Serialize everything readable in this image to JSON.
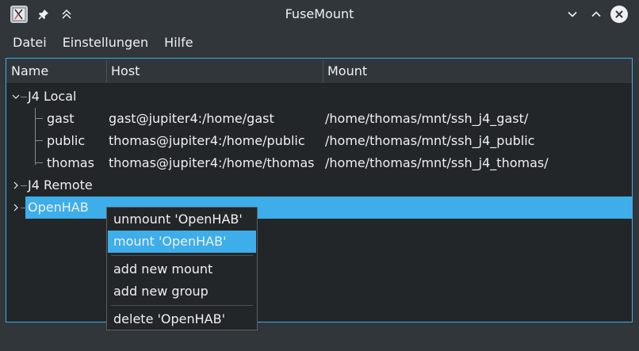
{
  "window": {
    "title": "FuseMount"
  },
  "menubar": {
    "items": [
      {
        "label": "Datei"
      },
      {
        "label": "Einstellungen"
      },
      {
        "label": "Hilfe"
      }
    ]
  },
  "tree": {
    "columns": [
      {
        "label": "Name"
      },
      {
        "label": "Host"
      },
      {
        "label": "Mount"
      }
    ],
    "groups": [
      {
        "name": "J4 Local",
        "expanded": true,
        "children": [
          {
            "name": "gast",
            "host": "gast@jupiter4:/home/gast",
            "mount": "/home/thomas/mnt/ssh_j4_gast/"
          },
          {
            "name": "public",
            "host": "thomas@jupiter4:/home/public",
            "mount": "/home/thomas/mnt/ssh_j4_public"
          },
          {
            "name": "thomas",
            "host": "thomas@jupiter4:/home/thomas",
            "mount": "/home/thomas/mnt/ssh_j4_thomas/"
          }
        ]
      },
      {
        "name": "J4 Remote",
        "expanded": false,
        "children": []
      },
      {
        "name": "OpenHAB",
        "expanded": false,
        "selected": true,
        "children": []
      }
    ]
  },
  "context_menu": {
    "items": [
      {
        "label": "unmount 'OpenHAB'"
      },
      {
        "label": "mount 'OpenHAB'",
        "active": true
      },
      {
        "label": "add new mount"
      },
      {
        "label": "add new group"
      },
      {
        "label": "delete 'OpenHAB'"
      }
    ]
  },
  "colors": {
    "accent": "#3daee9",
    "window_bg": "#31363b",
    "view_bg": "#232629",
    "text": "#eff0f1"
  }
}
